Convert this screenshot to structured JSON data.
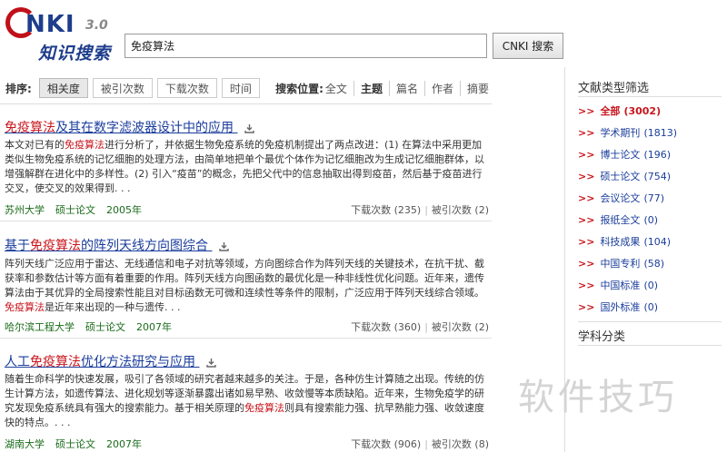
{
  "logo": {
    "brand": "NKI",
    "version": "3.0",
    "cn": "知识搜索"
  },
  "search": {
    "value": "免疫算法",
    "button": "CNKI 搜索"
  },
  "sortbar": {
    "label": "排序:",
    "tabs": [
      "相关度",
      "被引次数",
      "下载次数",
      "时间"
    ],
    "scope_label": "搜索位置:",
    "scopes": [
      "全文",
      "主题",
      "篇名",
      "作者",
      "摘要"
    ]
  },
  "results": [
    {
      "title_hl": "免疫算法",
      "title_rest": "及其在数字滤波器设计中的应用",
      "abstract": [
        {
          "t": "本文对已有的",
          "h": false
        },
        {
          "t": "免疫算法",
          "h": true
        },
        {
          "t": "进行分析了，并依据生物免疫系统的免疫机制提出了两点改进：(1) 在算法中采用更加类似生物免疫系统的记忆细胞的处理方法，由简单地把单个最优个体作为记忆细胞改为生成记忆细胞群体，以增强解群在进化中的多样性。(2) 引入“疫苗”的概念，先把父代中的信息抽取出得到疫苗，然后基于疫苗进行交叉，使交叉的效果得到. . .",
          "h": false
        }
      ],
      "org": "苏州大学",
      "type": "硕士论文",
      "year": "2005年",
      "downloads": "下载次数 (235)",
      "cites": "被引次数 (2)"
    },
    {
      "title_pre": "基于",
      "title_hl": "免疫算法",
      "title_rest": "的阵列天线方向图综合",
      "abstract": [
        {
          "t": "阵列天线广泛应用于雷达、无线通信和电子对抗等领域，方向图综合作为阵列天线的关键技术，在抗干扰、截获率和参数估计等方面有着重要的作用。阵列天线方向图函数的最优化是一种非线性优化问题。近年来，遗传算法由于其优异的全局搜索性能且对目标函数无可微和连续性等条件的限制，广泛应用于阵列天线综合领域。",
          "h": false
        },
        {
          "t": "免疫算法",
          "h": true
        },
        {
          "t": "是近年来出现的一种与遗传. . .",
          "h": false
        }
      ],
      "org": "哈尔滨工程大学",
      "type": "硕士论文",
      "year": "2007年",
      "downloads": "下载次数 (360)",
      "cites": "被引次数 (2)"
    },
    {
      "title_pre": "人工",
      "title_hl": "免疫算法",
      "title_rest": "优化方法研究与应用",
      "abstract": [
        {
          "t": "随着生命科学的快速发展，吸引了各领域的研究者越来越多的关注。于是，各种仿生计算随之出现。传统的仿生计算方法，如遗传算法、进化规划等逐渐暴露出诸如易早熟、收敛慢等本质缺陷。近年来，生物免疫学的研究发现免疫系统具有强大的搜索能力。基于相关原理的",
          "h": false
        },
        {
          "t": "免疫算法",
          "h": true
        },
        {
          "t": "则具有搜索能力强、抗早熟能力强、收敛速度快的特点。. . .",
          "h": false
        }
      ],
      "org": "湖南大学",
      "type": "硕士论文",
      "year": "2007年",
      "downloads": "下载次数 (906)",
      "cites": "被引次数 (8)"
    }
  ],
  "sidebar": {
    "filter_title": "文献类型筛选",
    "items": [
      {
        "label": "全部",
        "count": "(3002)"
      },
      {
        "label": "学术期刊",
        "count": "(1813)"
      },
      {
        "label": "博士论文",
        "count": "(196)"
      },
      {
        "label": "硕士论文",
        "count": "(754)"
      },
      {
        "label": "会议论文",
        "count": "(77)"
      },
      {
        "label": "报纸全文",
        "count": "(0)"
      },
      {
        "label": "科技成果",
        "count": "(104)"
      },
      {
        "label": "中国专利",
        "count": "(58)"
      },
      {
        "label": "中国标准",
        "count": "(0)"
      },
      {
        "label": "国外标准",
        "count": "(0)"
      }
    ],
    "subject_title": "学科分类"
  },
  "watermark": "软件技巧",
  "colors": {
    "link": "#1a3d9c",
    "highlight": "#c8161d",
    "org": "#1a6b1a"
  }
}
